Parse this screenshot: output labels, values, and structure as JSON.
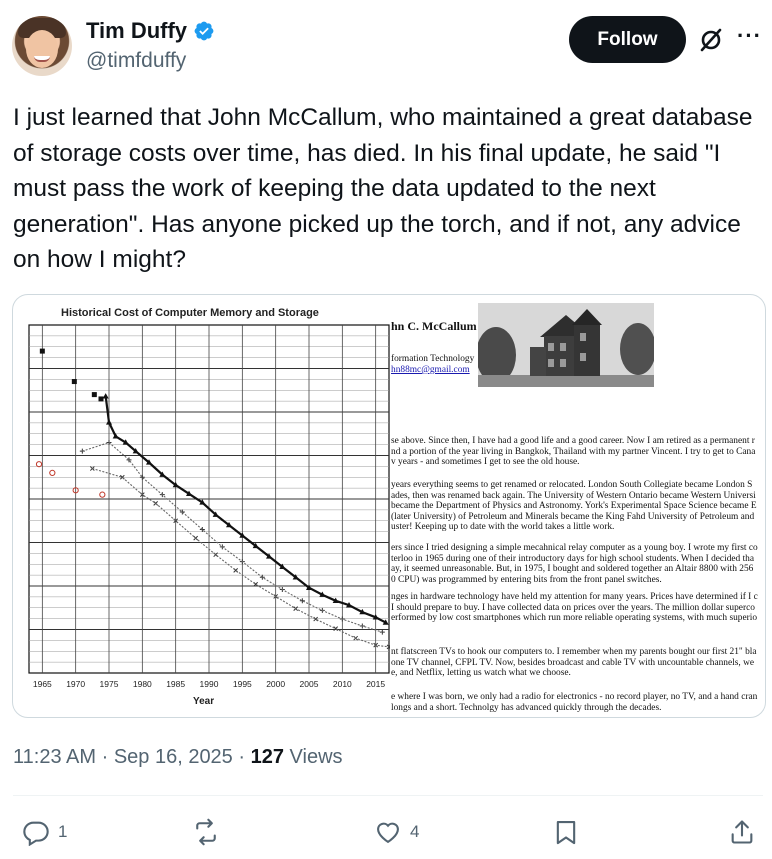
{
  "author": {
    "name": "Tim Duffy",
    "handle": "@timfduffy",
    "verified": true,
    "follow_label": "Follow",
    "icons": {
      "verified": "verified-badge-icon",
      "grok": "grok-icon",
      "more": "more-icon"
    }
  },
  "tweet": {
    "text": "I just learned that John McCallum, who maintained a great database of storage costs over time, has died. In his final update, he said \"I must pass the work of keeping the data updated to the next generation\". Has anyone picked up the torch, and if not, any advice on how I might?",
    "time": "11:23 AM",
    "date": "Sep 16, 2025",
    "views_count": "127",
    "views_label": "Views"
  },
  "media": {
    "chart_title": "Historical Cost of Computer Memory and Storage",
    "x_axis_label": "Year",
    "x_ticks": [
      "1965",
      "1970",
      "1975",
      "1980",
      "1985",
      "1990",
      "1995",
      "2000",
      "2005",
      "2010",
      "2015"
    ],
    "doc_header": {
      "name": "hn C. McCallum",
      "line2": "formation Technology",
      "email": "hn88mc@gmail.com"
    },
    "doc_paragraphs": [
      [
        "se above. Since then, I have had a good life and a good career. Now I am retired as a permanent r",
        "nd a portion of the year living in Bangkok, Thailand with my partner Vincent. I try to get to Cana",
        "v years - and sometimes I get to see the old house."
      ],
      [
        "years everything seems to get renamed or relocated. London South Collegiate became London S",
        "ades, then was renamed back again. The University of Western Ontario became Western Universi",
        "became the Department of Physics and Astronomy. York's Experimental Space Science became E",
        "(later University) of Petroleum and Minerals became the King Fahd University of Petroleum and",
        "uster! Keeping up to date with the world takes a little work."
      ],
      [
        "ers since I tried designing a simple mecahnical relay computer as a young boy. I wrote my first co",
        "terloo in 1965 during one of their introductory days for high school students. When I decided tha",
        "ay, it seemed unreasonable. But, in 1975, I bought and soldered together an Altair 8800 with 256",
        "0 CPU) was programmed by entering bits from the front panel switches."
      ],
      [
        "nges in hardware technology have held my attention for many years. Prices have determined if I c",
        "I should prepare to buy. I have collected data on prices over the years. The million dollar superco",
        "erformed by low cost smartphones which run more reliable operating systems, with much superio"
      ],
      [
        "nt flatscreen TVs to hook our computers to. I remember when my parents bought our first 21\" bla",
        "one TV channel, CFPL TV. Now, besides broadcast and cable TV with uncountable channels, we",
        "e, and Netflix, letting us watch what we choose."
      ],
      [
        "e where I was born, we only had a radio for electronics - no record player, no TV, and a hand cran",
        "longs and a short. Technolgy has advanced quickly through the decades."
      ]
    ]
  },
  "chart_data": {
    "type": "scatter",
    "title": "Historical Cost of Computer Memory and Storage",
    "xlabel": "Year",
    "ylabel": "",
    "x_range": [
      1963,
      2017
    ],
    "y_log_scale": true,
    "grid": true,
    "series": [
      {
        "marker": "square",
        "points": [
          [
            1965,
            3.2
          ],
          [
            1969.8,
            2.85
          ],
          [
            1972.8,
            2.7
          ],
          [
            1973.8,
            2.65
          ]
        ]
      },
      {
        "marker": "triangle",
        "points": [
          [
            1974.5,
            2.68
          ],
          [
            1975,
            2.38
          ],
          [
            1976,
            2.22
          ],
          [
            1977.5,
            2.15
          ],
          [
            1979,
            2.05
          ],
          [
            1981,
            1.92
          ],
          [
            1983,
            1.78
          ],
          [
            1985,
            1.66
          ],
          [
            1987,
            1.56
          ],
          [
            1989,
            1.46
          ],
          [
            1991,
            1.32
          ],
          [
            1993,
            1.2
          ],
          [
            1995,
            1.08
          ],
          [
            1997,
            0.96
          ],
          [
            1999,
            0.84
          ],
          [
            2001,
            0.72
          ],
          [
            2003,
            0.6
          ],
          [
            2005,
            0.48
          ],
          [
            2007,
            0.4
          ],
          [
            2009,
            0.33
          ],
          [
            2011,
            0.28
          ],
          [
            2013,
            0.2
          ],
          [
            2015,
            0.14
          ],
          [
            2016.5,
            0.08
          ]
        ]
      },
      {
        "marker": "plus",
        "points": [
          [
            1971,
            2.05
          ],
          [
            1975,
            2.15
          ],
          [
            1978,
            1.95
          ],
          [
            1980,
            1.75
          ],
          [
            1983,
            1.55
          ],
          [
            1986,
            1.35
          ],
          [
            1989,
            1.15
          ],
          [
            1992,
            0.95
          ],
          [
            1995,
            0.78
          ],
          [
            1998,
            0.6
          ],
          [
            2001,
            0.46
          ],
          [
            2004,
            0.33
          ],
          [
            2007,
            0.22
          ],
          [
            2010,
            0.12
          ],
          [
            2013,
            0.04
          ],
          [
            2016,
            -0.03
          ]
        ]
      },
      {
        "marker": "circle",
        "points": [
          [
            1964.5,
            1.9
          ],
          [
            1966.5,
            1.8
          ],
          [
            1970,
            1.6
          ],
          [
            1974,
            1.55
          ]
        ]
      },
      {
        "marker": "x",
        "points": [
          [
            1972.5,
            1.85
          ],
          [
            1977,
            1.75
          ],
          [
            1980,
            1.55
          ],
          [
            1982,
            1.45
          ],
          [
            1985,
            1.25
          ],
          [
            1988,
            1.05
          ],
          [
            1991,
            0.86
          ],
          [
            1994,
            0.68
          ],
          [
            1997,
            0.52
          ],
          [
            2000,
            0.38
          ],
          [
            2003,
            0.24
          ],
          [
            2006,
            0.12
          ],
          [
            2009,
            0.01
          ],
          [
            2012,
            -0.1
          ],
          [
            2015,
            -0.18
          ],
          [
            2017,
            -0.2
          ]
        ]
      }
    ]
  },
  "engagement": {
    "replies": "1",
    "reposts": "",
    "likes": "4",
    "icons": [
      "reply-icon",
      "repost-icon",
      "like-icon",
      "bookmark-icon",
      "share-icon"
    ]
  },
  "colors": {
    "text": "#0f1419",
    "secondary": "#536471",
    "border": "#cfd9de",
    "follow_bg": "#0f1419",
    "verified": "#1d9bf0",
    "circle_marker": "#c0392b"
  }
}
